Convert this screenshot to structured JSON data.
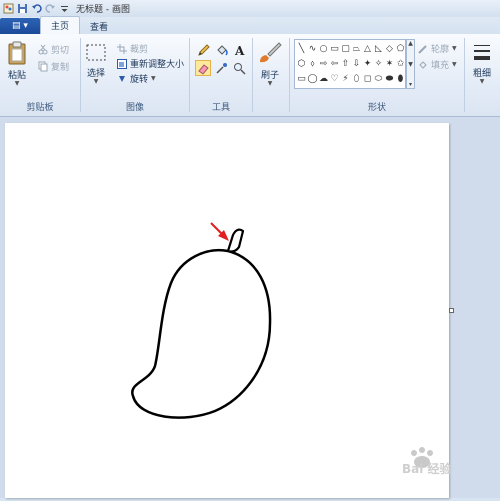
{
  "titlebar": {
    "title": "无标题 - 画图",
    "quick_access": [
      "app-icon",
      "save-icon",
      "undo-icon",
      "redo-icon",
      "customize-icon"
    ]
  },
  "tabs": {
    "file_menu": "▤ ▾",
    "items": [
      "主页",
      "查看"
    ],
    "active": "主页"
  },
  "ribbon": {
    "clipboard": {
      "paste_label": "粘贴",
      "cut_label": "剪切",
      "copy_label": "复制",
      "group_label": "剪贴板"
    },
    "image": {
      "select_label": "选择",
      "crop_label": "裁剪",
      "resize_label": "重新调整大小",
      "rotate_label": "旋转",
      "group_label": "图像"
    },
    "tools": {
      "group_label": "工具",
      "items": [
        "pencil-icon",
        "fill-icon",
        "text-icon",
        "eraser-icon",
        "color-picker-icon",
        "magnifier-icon"
      ],
      "selected": "eraser-icon"
    },
    "brushes": {
      "label": "刷子"
    },
    "shapes": {
      "group_label": "形状",
      "outline_label": "轮廓",
      "fill_label": "填充",
      "items": [
        "╲",
        "∿",
        "○",
        "▭",
        "▢",
        "⏢",
        "△",
        "◺",
        "◇",
        "⬠",
        "⬡",
        "⬨",
        "⇨",
        "⇦",
        "⇧",
        "⇩",
        "✦",
        "✧",
        "✶",
        "✩",
        "▭",
        "◯",
        "☁",
        "♡",
        "⚡",
        "⬯",
        "◻",
        "⬭",
        "⬬",
        "⬮"
      ]
    },
    "size": {
      "label": "粗细"
    }
  },
  "canvas": {
    "content": "hand-drawn mango outline with stem, red arrow pointing to stem"
  },
  "watermark": {
    "text": "Bai 经验"
  },
  "colors": {
    "accent": "#1b4a98",
    "arrow": "#e02020",
    "canvas": "#ffffff",
    "workarea": "#d0dcec"
  }
}
